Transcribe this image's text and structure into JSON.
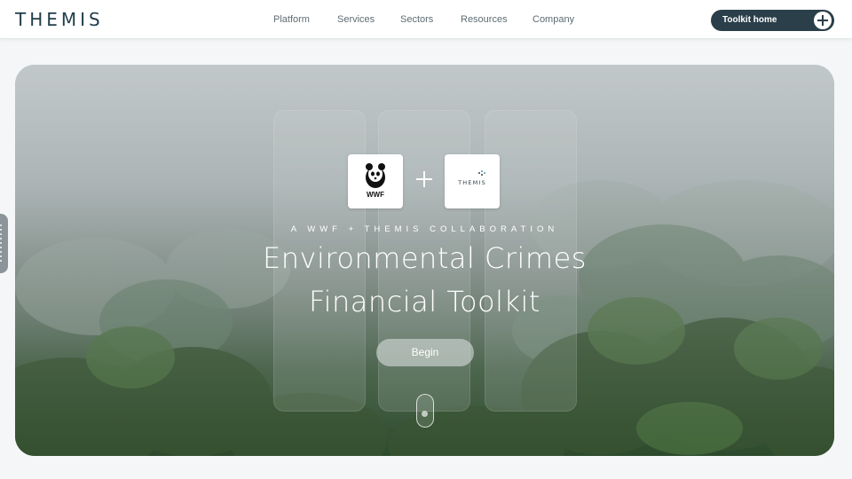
{
  "header": {
    "brand": "THEMIS",
    "nav": [
      "Platform",
      "Services",
      "Sectors",
      "Resources",
      "Company"
    ],
    "cta_label": "Toolkit home"
  },
  "hero": {
    "logos": {
      "left_label": "WWF",
      "right_label": "THEMIS"
    },
    "eyebrow": "A WWF + THEMIS COLLABORATION",
    "title_line_1": "Environmental Crimes",
    "title_line_2": "Financial Toolkit",
    "begin_label": "Begin"
  },
  "colors": {
    "brand": "#1f3d4a",
    "button_dark": "#2b3f4a",
    "nav_text": "#5e6c72"
  },
  "icons": {
    "cta": "plus-circle-icon",
    "collab": "plus-icon",
    "scroll": "mouse-scroll-icon",
    "wwf": "panda-icon"
  }
}
